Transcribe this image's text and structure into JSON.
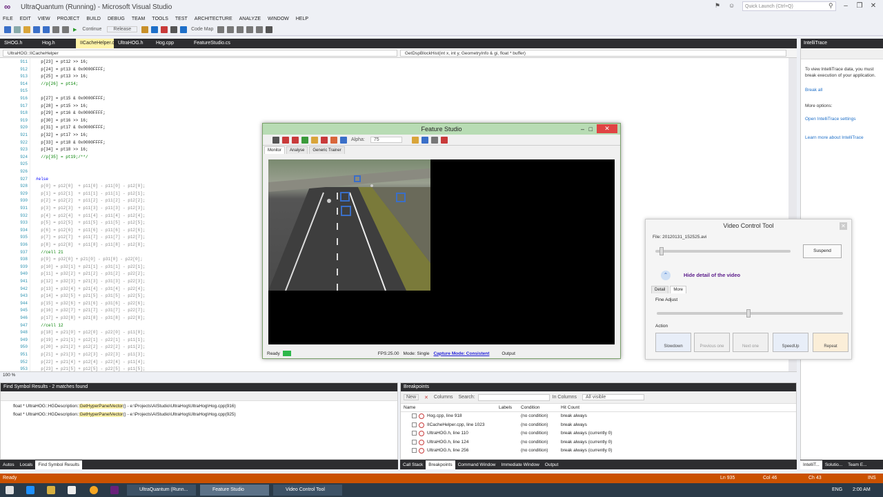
{
  "window": {
    "title": "UltraQuantum (Running) - Microsoft Visual Studio",
    "quick_launch_placeholder": "Quick Launch (Ctrl+Q)"
  },
  "menu": [
    "FILE",
    "EDIT",
    "VIEW",
    "PROJECT",
    "BUILD",
    "DEBUG",
    "TEAM",
    "TOOLS",
    "TEST",
    "ARCHITECTURE",
    "ANALYZE",
    "WINDOW",
    "HELP"
  ],
  "toolbar": {
    "continue_label": "Continue",
    "config": "Release",
    "codemap_label": "Code Map"
  },
  "doc_tabs": [
    "SHOG.h",
    "Hog.h",
    "IICacheHelper.cpp",
    "UltraHOG.h",
    "Hog.cpp",
    "FeatureStudio.cs"
  ],
  "active_doc_tab": "IICacheHelper.cpp",
  "nav": {
    "scope": "UltraHOG::IICacheHelper",
    "member": "GetDspBlockHist(int x, int y, GeometryInfo & gi, float * buffer)"
  },
  "code": {
    "line_numbers": [
      "911",
      "912",
      "913",
      "914",
      "915",
      "916",
      "917",
      "918",
      "919",
      "920",
      "921",
      "922",
      "923",
      "924",
      "925",
      "926",
      "927",
      "928",
      "929",
      "930",
      "931",
      "932",
      "933",
      "934",
      "935",
      "936",
      "937",
      "938",
      "939",
      "940",
      "941",
      "942",
      "943",
      "944",
      "945",
      "946",
      "947",
      "948",
      "949",
      "950",
      "951",
      "952",
      "953"
    ],
    "lines": [
      "  p[23] = pt12 >> 16;",
      "  p[24] = pt13 & 0x0000FFFF;",
      "  p[25] = pt13 >> 16;",
      "  //p[26] = pt14;",
      "",
      "  p[27] = pt15 & 0x0000FFFF;",
      "  p[28] = pt15 >> 16;",
      "  p[29] = pt16 & 0x0000FFFF;",
      "  p[30] = pt16 >> 16;",
      "  p[31] = pt17 & 0x0000FFFF;",
      "  p[32] = pt17 >> 16;",
      "  p[33] = pt18 & 0x0000FFFF;",
      "  p[34] = pt18 >> 16;",
      "  //p[35] = pt19;/**/",
      "",
      "",
      "#else",
      "  p[0] = p12[0]  + p11[0] - p11[0] - p12[0];",
      "  p[1] = p12[1]  + p11[1] - p11[1] - p12[1];",
      "  p[2] = p12[2]  + p11[2] - p11[2] - p12[2];",
      "  p[3] = p12[3]  + p11[3] - p11[3] - p12[3];",
      "  p[4] = p12[4]  + p11[4] - p11[4] - p12[4];",
      "  p[5] = p12[5]  + p11[5] - p11[5] - p12[5];",
      "  p[6] = p12[6]  + p11[6] - p11[6] - p12[6];",
      "  p[7] = p12[7]  + p11[7] - p11[7] - p12[7];",
      "  p[8] = p12[8]  + p11[8] - p11[8] - p12[8];",
      "  //cell 21",
      "  p[9] = p32[0] + p21[0] - p31[0] - p22[0];",
      "  p[10] = p32[1] + p21[1] - p31[1] - p22[1];",
      "  p[11] = p32[2] + p21[2] - p31[2] - p22[2];",
      "  p[12] = p32[3] + p21[3] - p31[3] - p22[3];",
      "  p[13] = p32[4] + p21[4] - p31[4] - p22[4];",
      "  p[14] = p32[5] + p21[5] - p31[5] - p22[5];",
      "  p[15] = p32[6] + p21[6] - p31[6] - p22[6];",
      "  p[16] = p32[7] + p21[7] - p31[7] - p22[7];",
      "  p[17] = p32[8] + p21[8] - p31[8] - p22[8];",
      "  //cell 12",
      "  p[18] = p21[0] + p12[0] - p22[0] - p11[0];",
      "  p[19] = p21[1] + p12[1] - p22[1] - p11[1];",
      "  p[20] = p21[2] + p12[2] - p22[2] - p11[2];",
      "  p[21] = p21[3] + p12[3] - p22[3] - p11[3];",
      "  p[22] = p21[4] + p12[4] - p22[4] - p11[4];",
      "  p[23] = p21[5] + p12[5] - p22[5] - p11[5];"
    ],
    "zoom": "100 %"
  },
  "intellitrace": {
    "title": "IntelliTrace",
    "msg": "To view IntelliTrace data, you must break execution of your application.",
    "break_all": "Break all",
    "more_options": "More options:",
    "open_settings": "Open IntelliTrace settings",
    "learn_more": "Learn more about IntelliTrace"
  },
  "feature_studio": {
    "title": "Feature Studio",
    "alpha_label": "Alpha:",
    "alpha_value": "75",
    "tabs": [
      "Monitor",
      "Analyse",
      "Generic Trainer"
    ],
    "status_ready": "Ready",
    "fps": "FPS:25.00",
    "mode": "Mode: Single",
    "capture_mode": "Capture Mode: Consistent",
    "output": "Output"
  },
  "video_control": {
    "title": "Video Control Tool",
    "file": "File: 20120131_152525.avi",
    "suspend": "Suspend",
    "hide_detail": "Hide detail of the video",
    "tabs": [
      "Detail",
      "More"
    ],
    "fine_adjust": "Fine Adjust",
    "action": "Action",
    "buttons": [
      "Slowdown",
      "Previous one",
      "Next one",
      "SpeedUp",
      "Repeat"
    ]
  },
  "find_symbol": {
    "title": "Find Symbol Results - 2 matches found",
    "results": [
      {
        "prefix": "float * UltraHOG::HGDescription::",
        "match": "GetHyperPanelVector",
        "suffix": "() - e:\\Projects\\AIStudio\\UltraHog\\UltraHog\\Hog.cpp(916)"
      },
      {
        "prefix": "float * UltraHOG::HGDescription::",
        "match": "GetHyperPanelVector",
        "suffix": "() - e:\\Projects\\AIStudio\\UltraHog\\UltraHog\\Hog.cpp(925)"
      }
    ]
  },
  "breakpoints": {
    "title": "Breakpoints",
    "new_label": "New",
    "columns_label": "Columns",
    "search_label": "Search:",
    "in_columns_label": "In Columns",
    "in_columns_value": "All visible",
    "headers": [
      "Name",
      "Labels",
      "Condition",
      "Hit Count"
    ],
    "rows": [
      {
        "name": "Hog.cpp, line 918",
        "condition": "(no condition)",
        "hit": "break always"
      },
      {
        "name": "IICacheHelper.cpp, line 1023",
        "condition": "(no condition)",
        "hit": "break always"
      },
      {
        "name": "UltraHOG.h, line 110",
        "condition": "(no condition)",
        "hit": "break always (currently 0)"
      },
      {
        "name": "UltraHOG.h, line 124",
        "condition": "(no condition)",
        "hit": "break always (currently 0)"
      },
      {
        "name": "UltraHOG.h, line 256",
        "condition": "(no condition)",
        "hit": "break always (currently 0)"
      }
    ]
  },
  "bottom_tabs_left": [
    "Autos",
    "Locals",
    "Find Symbol Results"
  ],
  "bottom_tabs_right": [
    "Call Stack",
    "Breakpoints",
    "Command Window",
    "Immediate Window",
    "Output"
  ],
  "bottom_tabs_side": [
    "IntelliT...",
    "Solutio...",
    "Team E..."
  ],
  "status": {
    "text": "Ready",
    "ln": "Ln 935",
    "col": "Col 46",
    "ch": "Ch 43",
    "ins": "INS"
  },
  "taskbar": {
    "apps": [
      "UltraQuantum (Runn...",
      "Feature Studio",
      "Video Control Tool"
    ],
    "lang": "ENG",
    "time": "2:00 AM"
  },
  "colors": {
    "status_orange": "#ca5100",
    "vs_purple": "#68217a",
    "fs_green": "#b8dcb4"
  }
}
